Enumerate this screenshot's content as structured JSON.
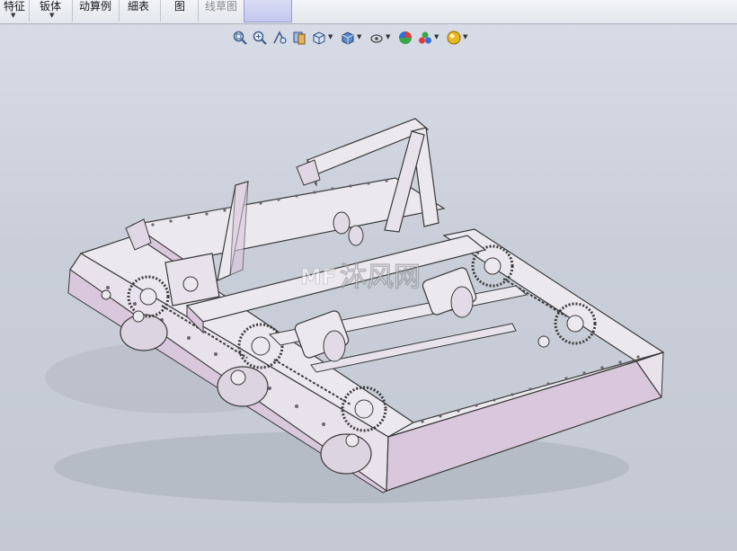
{
  "ribbon": {
    "items": [
      {
        "label": "特征"
      },
      {
        "label": "钣体"
      },
      {
        "label": "动算例"
      },
      {
        "label": "細表"
      },
      {
        "label": "图"
      },
      {
        "label": "线草图"
      }
    ]
  },
  "heads_up_toolbar": {
    "icons": [
      "zoom-to-fit-icon",
      "zoom-to-area-icon",
      "previous-view-icon",
      "section-view-icon",
      "view-orientation-icon",
      "display-style-icon",
      "hide-show-items-icon",
      "edit-appearance-icon",
      "apply-scene-icon",
      "view-settings-icon"
    ]
  },
  "watermark": {
    "text": "沐风网"
  },
  "colors": {
    "part_fill": "#ece8f0",
    "part_side": "#d9c8dc",
    "edge": "#3a3a3a",
    "background_top": "#d9dde7",
    "background_bottom": "#c4c9d3"
  }
}
